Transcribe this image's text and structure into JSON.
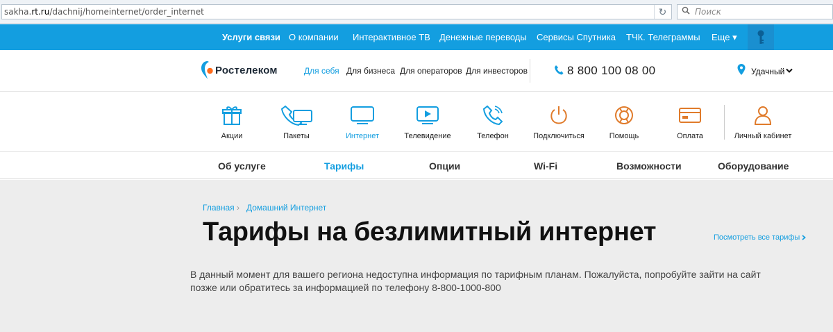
{
  "browser": {
    "url_prefix": "sakha.",
    "url_domain": "rt.ru",
    "url_path": "/dachnij/homeinternet/order_internet",
    "search_placeholder": "Поиск"
  },
  "topnav": {
    "items": [
      {
        "label": "Услуги связи"
      },
      {
        "label": "О компании"
      },
      {
        "label": "Интерактивное ТВ"
      },
      {
        "label": "Денежные переводы"
      },
      {
        "label": "Сервисы Спутника"
      },
      {
        "label": "ТЧК. Телеграммы"
      },
      {
        "label": "Еще ▾"
      }
    ]
  },
  "header": {
    "brand": "Ростелеком",
    "segments": [
      {
        "label": "Для себя"
      },
      {
        "label": "Для бизнеса"
      },
      {
        "label": "Для операторов"
      },
      {
        "label": "Для инвесторов"
      }
    ],
    "phone": "8 800 100 08 00",
    "city": "Удачный"
  },
  "icons": [
    {
      "label": "Акции",
      "icon": "gift-icon"
    },
    {
      "label": "Пакеты",
      "icon": "bundle-icon"
    },
    {
      "label": "Интернет",
      "icon": "monitor-icon"
    },
    {
      "label": "Телевидение",
      "icon": "tv-icon"
    },
    {
      "label": "Телефон",
      "icon": "phone-icon"
    },
    {
      "label": "Подключиться",
      "icon": "power-icon"
    },
    {
      "label": "Помощь",
      "icon": "lifebuoy-icon"
    },
    {
      "label": "Оплата",
      "icon": "card-icon"
    },
    {
      "label": "Личный кабинет",
      "icon": "user-icon"
    }
  ],
  "colors": {
    "accent": "#139ee0",
    "orange": "#e07b2b",
    "content_bg": "#ededed"
  },
  "subtabs": [
    {
      "label": "Об услуге"
    },
    {
      "label": "Тарифы"
    },
    {
      "label": "Опции"
    },
    {
      "label": "Wi-Fi"
    },
    {
      "label": "Возможности"
    },
    {
      "label": "Оборудование"
    }
  ],
  "content": {
    "breadcrumb": [
      {
        "label": "Главная"
      },
      {
        "label": "Домашний Интернет"
      }
    ],
    "breadcrumb_sep": "›",
    "title": "Тарифы на безлимитный интернет",
    "all_tariffs_link": "Посмотреть все тарифы",
    "message": "В данный момент для вашего региона недоступна информация по тарифным планам. Пожалуйста, попробуйте зайти на сайт позже или обратитесь за информацией по телефону 8-800-1000-800"
  }
}
